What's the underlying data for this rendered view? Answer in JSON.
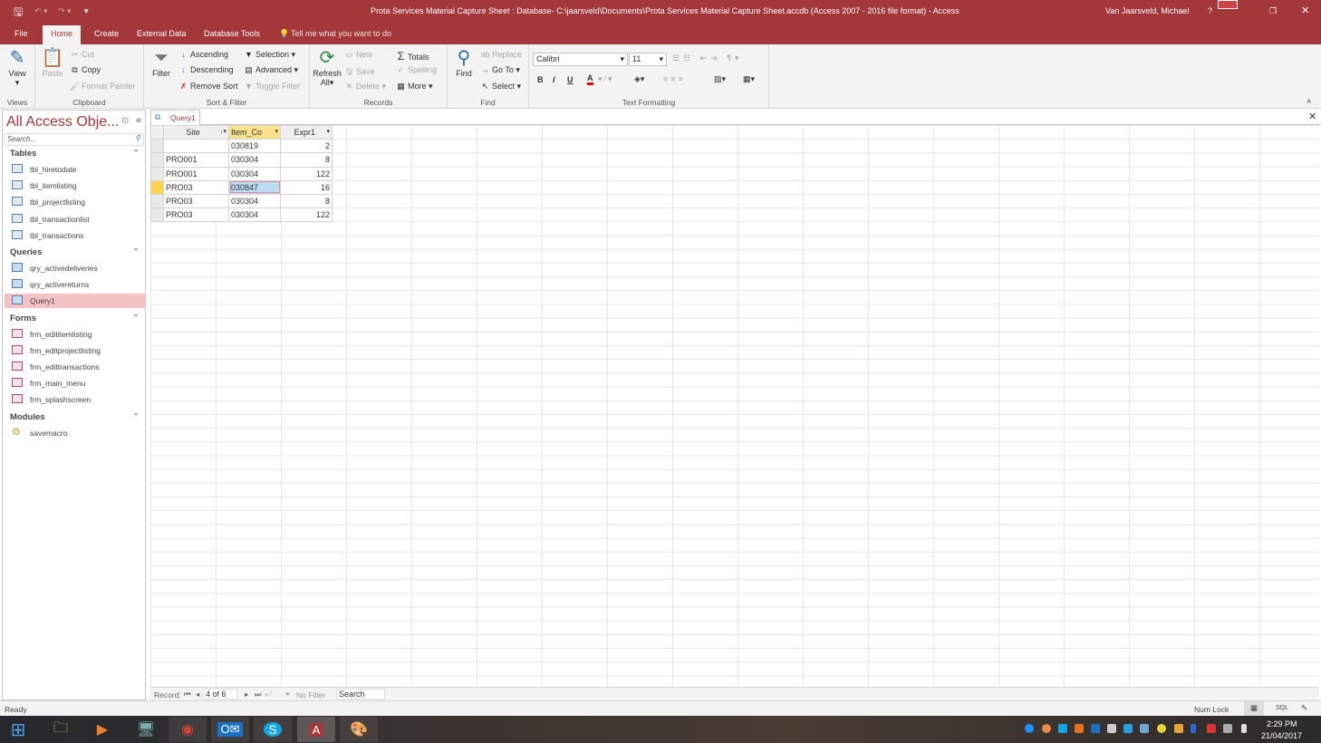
{
  "window": {
    "title": "Prota Services Material Capture Sheet : Database- C:\\jaarsveld\\Documents\\Prota Services Material Capture Sheet.accdb (Access 2007 - 2016 file format) - Access",
    "user": "Van Jaarsveld, Michael",
    "help": "?"
  },
  "tabs": [
    "File",
    "Home",
    "Create",
    "External Data",
    "Database Tools"
  ],
  "tell_me": "Tell me what you want to do",
  "ribbon": {
    "views": {
      "label": "Views",
      "view": "View"
    },
    "clipboard": {
      "label": "Clipboard",
      "paste": "Paste",
      "cut": "Cut",
      "copy": "Copy",
      "format_painter": "Format Painter"
    },
    "sort_filter": {
      "label": "Sort & Filter",
      "filter": "Filter",
      "ascending": "Ascending",
      "descending": "Descending",
      "remove_sort": "Remove Sort",
      "selection": "Selection",
      "advanced": "Advanced",
      "toggle_filter": "Toggle Filter"
    },
    "records": {
      "label": "Records",
      "refresh": "Refresh",
      "refresh2": "All",
      "new": "New",
      "save": "Save",
      "delete": "Delete",
      "totals": "Totals",
      "spelling": "Spelling",
      "more": "More"
    },
    "find": {
      "label": "Find",
      "find": "Find",
      "replace": "Replace",
      "goto": "Go To",
      "select": "Select"
    },
    "text_formatting": {
      "label": "Text Formatting",
      "font": "Calibri",
      "size": "11",
      "bold": "B",
      "italic": "I",
      "underline": "U"
    }
  },
  "nav": {
    "title": "All Access Obje...",
    "search_placeholder": "Search...",
    "sections": [
      {
        "name": "Tables",
        "items": [
          "tbl_hiretodate",
          "tbl_itemlisting",
          "tbl_projectlisting",
          "tbl_transactionlist",
          "tbl_transactions"
        ]
      },
      {
        "name": "Queries",
        "items": [
          "qry_activedeliveries",
          "qry_activereturns",
          "Query1"
        ]
      },
      {
        "name": "Forms",
        "items": [
          "frm_edititemlisting",
          "frm_editprojectlisting",
          "frm_edittransactions",
          "frm_main_menu",
          "frm_splashscreen"
        ]
      },
      {
        "name": "Modules",
        "items": [
          "savemacro"
        ]
      }
    ],
    "selected": "Query1"
  },
  "document": {
    "tab": "Query1"
  },
  "datasheet": {
    "columns": [
      "Site",
      "Item_Co",
      "Expr1"
    ],
    "rows": [
      [
        "",
        "030819",
        "2"
      ],
      [
        "PRO001",
        "030304",
        "8"
      ],
      [
        "PRO001",
        "030304",
        "122"
      ],
      [
        "PRO03",
        "030847",
        "16"
      ],
      [
        "PRO03",
        "030304",
        "8"
      ],
      [
        "PRO03",
        "030304",
        "122"
      ]
    ],
    "current_row": 4
  },
  "record_nav": {
    "label": "Record:",
    "position": "4 of 6",
    "filter": "No Filter",
    "search": "Search"
  },
  "status": {
    "left": "Ready",
    "num_lock": "Num Lock",
    "sql": "SQL"
  },
  "taskbar": {
    "time": "2:29 PM",
    "date": "21/04/2017"
  },
  "colors": {
    "accent": "#a4373a",
    "selected_nav": "#f4c2c5",
    "header_selected": "#fce18b"
  }
}
